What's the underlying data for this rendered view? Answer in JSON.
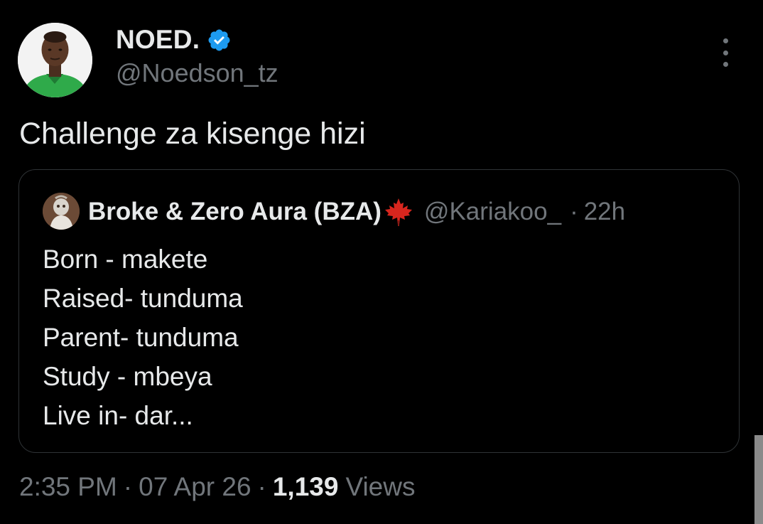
{
  "author": {
    "display_name": "NOED.",
    "handle": "@Noedson_tz",
    "verified": true
  },
  "tweet": {
    "text": "Challenge za kisenge hizi"
  },
  "quote": {
    "display_name": "Broke & Zero Aura (BZA)",
    "emoji": "maple-leaf",
    "handle": "@Kariakoo_",
    "separator": "·",
    "time": "22h",
    "lines": [
      "Born - makete",
      "Raised- tunduma",
      "Parent- tunduma",
      "Study - mbeya",
      "Live in- dar..."
    ]
  },
  "meta": {
    "time": "2:35 PM",
    "date": "07 Apr 26",
    "separator": "·",
    "views_count": "1,139",
    "views_label": "Views"
  },
  "colors": {
    "background": "#000000",
    "primary_text": "#e7e9ea",
    "secondary_text": "#71767b",
    "verified_blue": "#1d9bf0",
    "border": "#2f3336"
  }
}
